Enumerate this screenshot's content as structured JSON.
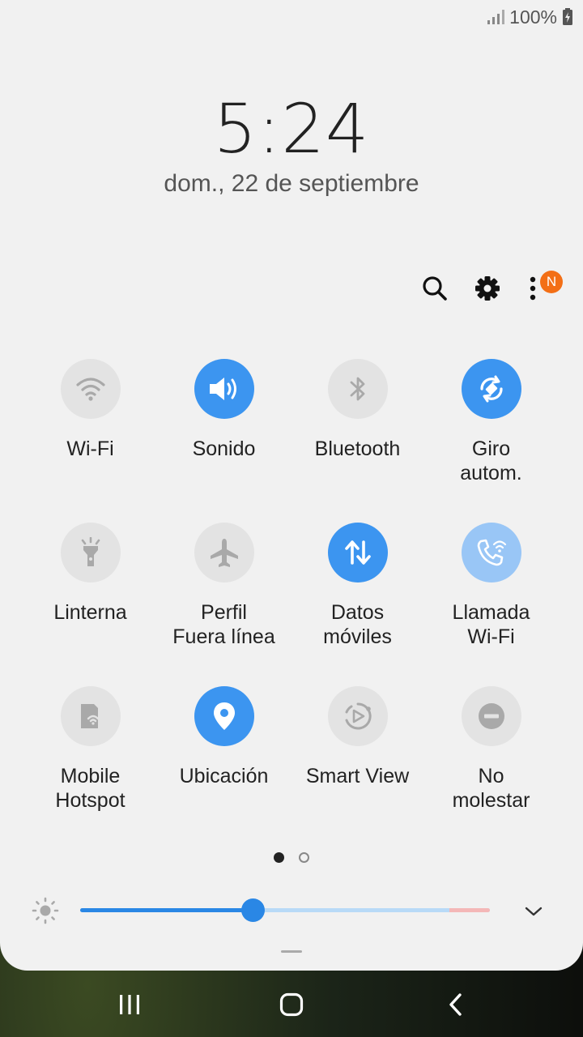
{
  "status_bar": {
    "battery": "100%"
  },
  "lock": {
    "time": "5:24",
    "date": "dom., 22 de septiembre"
  },
  "top_actions": {
    "badge": "N"
  },
  "tiles": [
    {
      "label": "Wi-Fi",
      "icon": "wifi-icon",
      "state": "off"
    },
    {
      "label": "Sonido",
      "icon": "sound-icon",
      "state": "on"
    },
    {
      "label": "Bluetooth",
      "icon": "bluetooth-icon",
      "state": "off"
    },
    {
      "label": "Giro\nautom.",
      "icon": "auto-rotate-icon",
      "state": "on"
    },
    {
      "label": "Linterna",
      "icon": "flashlight-icon",
      "state": "off"
    },
    {
      "label": "Perfil\nFuera línea",
      "icon": "airplane-icon",
      "state": "off"
    },
    {
      "label": "Datos\nmóviles",
      "icon": "mobile-data-icon",
      "state": "on"
    },
    {
      "label": "Llamada\nWi-Fi",
      "icon": "wifi-call-icon",
      "state": "dim"
    },
    {
      "label": "Mobile\nHotspot",
      "icon": "hotspot-icon",
      "state": "off"
    },
    {
      "label": "Ubicación",
      "icon": "location-icon",
      "state": "on"
    },
    {
      "label": "Smart View",
      "icon": "smart-view-icon",
      "state": "off"
    },
    {
      "label": "No\nmolestar",
      "icon": "do-not-disturb-icon",
      "state": "off"
    }
  ],
  "pager": {
    "pages": 2,
    "current": 1
  },
  "brightness": {
    "level": 0.42
  },
  "colors": {
    "accent": "#3c95f0",
    "panel": "#f1f1f1",
    "badge": "#f36f16"
  }
}
